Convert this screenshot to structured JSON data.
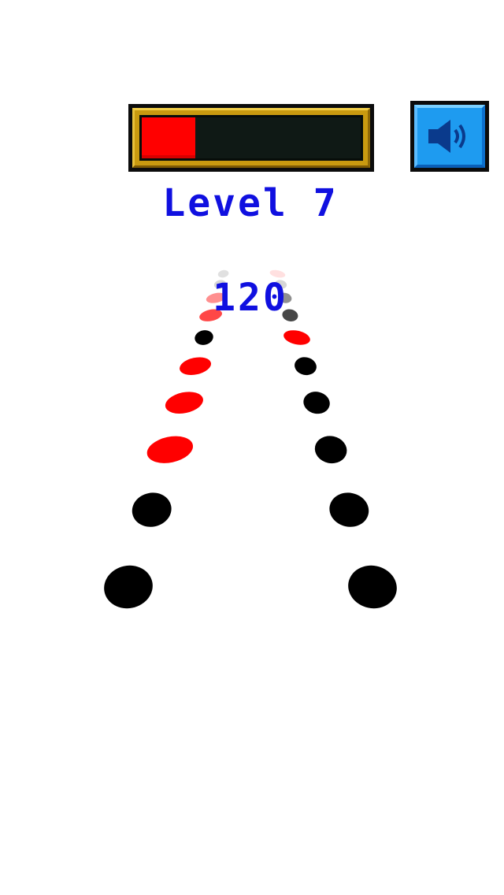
{
  "hud": {
    "level_text": "Level 7",
    "score": "120",
    "progress_fraction": 0.25,
    "progress_color": "#ff0000",
    "sound_icon": "speaker-icon",
    "sound_on": true
  },
  "colors": {
    "text": "#1010e0",
    "dot_black": "#000000",
    "dot_red": "#ff0000",
    "button_blue": "#1e9bf0",
    "frame_gold": "#c99a10"
  },
  "track": {
    "lanes": [
      "left",
      "right"
    ],
    "tiles": [
      {
        "lane": "left",
        "row": 1,
        "color": "black"
      },
      {
        "lane": "right",
        "row": 1,
        "color": "black"
      },
      {
        "lane": "left",
        "row": 2,
        "color": "black"
      },
      {
        "lane": "right",
        "row": 2,
        "color": "black"
      },
      {
        "lane": "left",
        "row": 3,
        "color": "red"
      },
      {
        "lane": "right",
        "row": 3,
        "color": "black"
      },
      {
        "lane": "left",
        "row": 4,
        "color": "red"
      },
      {
        "lane": "right",
        "row": 4,
        "color": "black"
      },
      {
        "lane": "left",
        "row": 5,
        "color": "red"
      },
      {
        "lane": "right",
        "row": 5,
        "color": "black"
      },
      {
        "lane": "left",
        "row": 6,
        "color": "black"
      },
      {
        "lane": "right",
        "row": 6,
        "color": "red"
      },
      {
        "lane": "left",
        "row": 7,
        "color": "red"
      },
      {
        "lane": "right",
        "row": 7,
        "color": "black"
      },
      {
        "lane": "left",
        "row": 8,
        "color": "red"
      },
      {
        "lane": "right",
        "row": 8,
        "color": "black"
      },
      {
        "lane": "left",
        "row": 9,
        "color": "black"
      },
      {
        "lane": "right",
        "row": 9,
        "color": "black"
      },
      {
        "lane": "left",
        "row": 10,
        "color": "black"
      },
      {
        "lane": "right",
        "row": 10,
        "color": "red"
      }
    ]
  }
}
